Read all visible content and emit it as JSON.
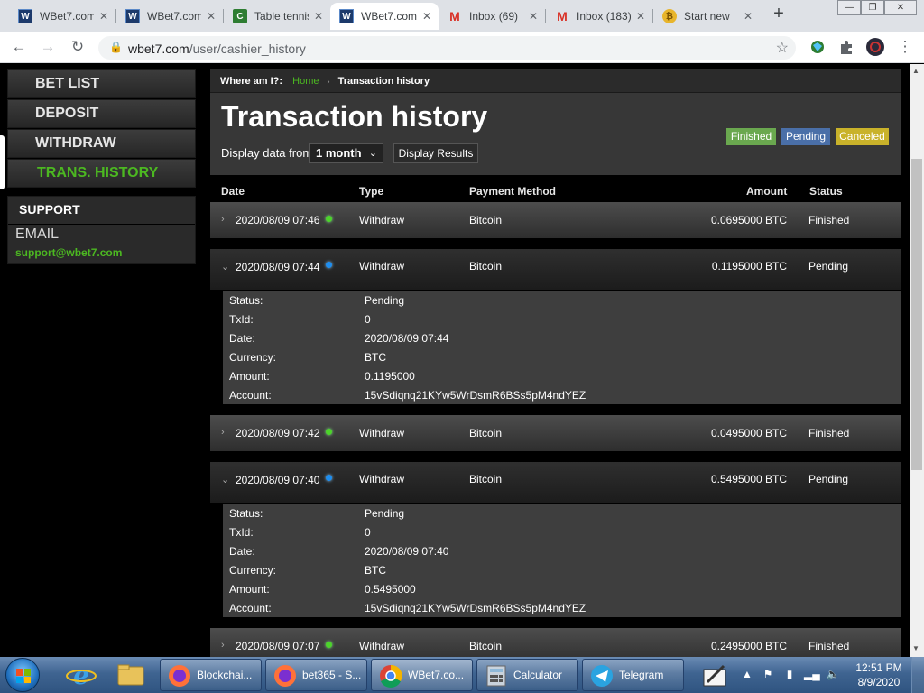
{
  "browser": {
    "tabs": [
      {
        "title": "WBet7.com",
        "icon": "wbet7-icon"
      },
      {
        "title": "WBet7.com",
        "icon": "wbet7-icon"
      },
      {
        "title": "Table tennis",
        "icon": "green-square-icon"
      },
      {
        "title": "WBet7.com",
        "icon": "wbet7-icon"
      },
      {
        "title": "Inbox (69)",
        "icon": "gmail-icon"
      },
      {
        "title": "Inbox (183)",
        "icon": "gmail-icon"
      },
      {
        "title": "Start new",
        "icon": "coin-icon"
      }
    ],
    "url_host": "wbet7.com",
    "url_path": "/user/cashier_history"
  },
  "sidebar": {
    "items": [
      "BET LIST",
      "DEPOSIT",
      "WITHDRAW",
      "TRANS. HISTORY"
    ],
    "active_index": 3,
    "support_title": "SUPPORT",
    "email_label": "EMAIL",
    "email_value": "support@wbet7.com"
  },
  "header": {
    "breadcrumb_label": "Where am I?:",
    "breadcrumb_home": "Home",
    "breadcrumb_current": "Transaction history",
    "title": "Transaction history",
    "display_label": "Display data from",
    "period_value": "1 month",
    "display_button": "Display Results",
    "legend": [
      {
        "label": "Finished",
        "color": "#6aa84f"
      },
      {
        "label": "Pending",
        "color": "#4a6fa8"
      },
      {
        "label": "Canceled",
        "color": "#c9b22a"
      }
    ]
  },
  "table": {
    "columns": [
      "Date",
      "Type",
      "Payment Method",
      "Amount",
      "Status"
    ],
    "rows": [
      {
        "date": "2020/08/09 07:46",
        "type": "Withdraw",
        "method": "Bitcoin",
        "amount": "0.0695000 BTC",
        "status": "Finished",
        "dot": "green",
        "expanded": false
      },
      {
        "date": "2020/08/09 07:44",
        "type": "Withdraw",
        "method": "Bitcoin",
        "amount": "0.1195000 BTC",
        "status": "Pending",
        "dot": "blue",
        "expanded": true,
        "details": [
          [
            "Status:",
            "Pending"
          ],
          [
            "TxId:",
            "0"
          ],
          [
            "Date:",
            "2020/08/09 07:44"
          ],
          [
            "Currency:",
            "BTC"
          ],
          [
            "Amount:",
            "0.1195000"
          ],
          [
            "Account:",
            "15vSdiqnq21KYw5WrDsmR6BSs5pM4ndYEZ"
          ]
        ]
      },
      {
        "date": "2020/08/09 07:42",
        "type": "Withdraw",
        "method": "Bitcoin",
        "amount": "0.0495000 BTC",
        "status": "Finished",
        "dot": "green",
        "expanded": false
      },
      {
        "date": "2020/08/09 07:40",
        "type": "Withdraw",
        "method": "Bitcoin",
        "amount": "0.5495000 BTC",
        "status": "Pending",
        "dot": "blue",
        "expanded": true,
        "details": [
          [
            "Status:",
            "Pending"
          ],
          [
            "TxId:",
            "0"
          ],
          [
            "Date:",
            "2020/08/09 07:40"
          ],
          [
            "Currency:",
            "BTC"
          ],
          [
            "Amount:",
            "0.5495000"
          ],
          [
            "Account:",
            "15vSdiqnq21KYw5WrDsmR6BSs5pM4ndYEZ"
          ]
        ]
      },
      {
        "date": "2020/08/09 07:07",
        "type": "Withdraw",
        "method": "Bitcoin",
        "amount": "0.2495000 BTC",
        "status": "Finished",
        "dot": "green",
        "expanded": false
      }
    ]
  },
  "taskbar": {
    "items": [
      {
        "label": "Blockchai...",
        "icon": "firefox-icon"
      },
      {
        "label": "bet365 - S...",
        "icon": "firefox-icon"
      },
      {
        "label": "WBet7.co...",
        "icon": "chrome-icon"
      },
      {
        "label": "Calculator",
        "icon": "calculator-icon"
      },
      {
        "label": "Telegram",
        "icon": "telegram-icon"
      }
    ],
    "time": "12:51 PM",
    "date": "8/9/2020"
  }
}
